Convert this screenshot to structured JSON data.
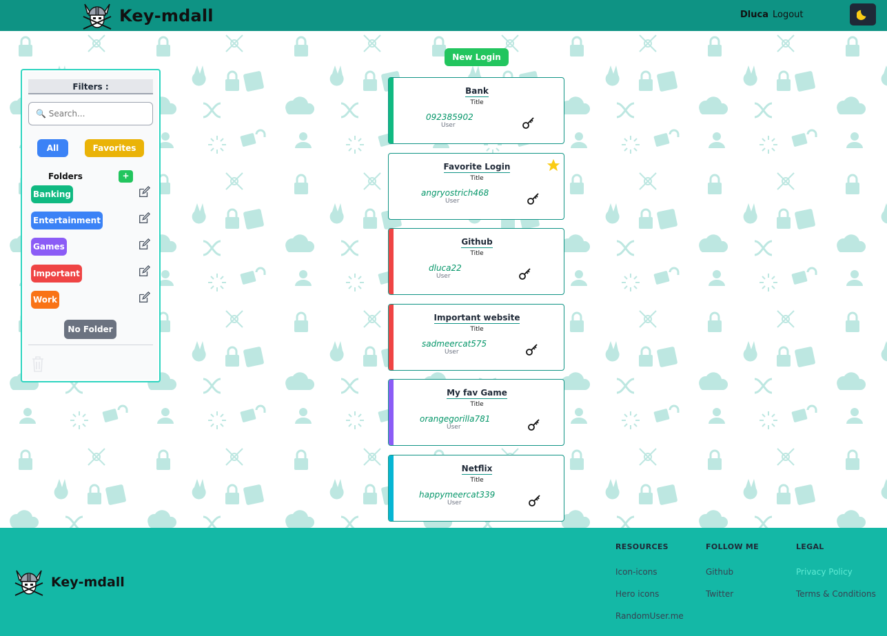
{
  "header": {
    "brand_name": "Key-mdall",
    "username": "Dluca",
    "logout_label": "Logout",
    "theme_icon": "moon-icon"
  },
  "sidebar": {
    "filters_title": "Filters :",
    "search_placeholder": "🔍 Search...",
    "all_label": "All",
    "favorites_label": "Favorites",
    "folders_label": "Folders",
    "add_folder_label": "+",
    "folders": [
      {
        "label": "Banking",
        "color": "#10b981"
      },
      {
        "label": "Entertainment",
        "color": "#3b82f6"
      },
      {
        "label": "Games",
        "color": "#8b5cf6"
      },
      {
        "label": "Important",
        "color": "#ef4444"
      },
      {
        "label": "Work",
        "color": "#f97316"
      }
    ],
    "no_folder_label": "No Folder"
  },
  "main": {
    "new_login_label": "New Login",
    "title_caption": "Title",
    "user_caption": "User",
    "logins": [
      {
        "title": "Bank",
        "user": "092385902",
        "color": "#10b981",
        "favorite": false
      },
      {
        "title": "Favorite Login",
        "user": "angryostrich468",
        "color": "",
        "favorite": true
      },
      {
        "title": "Github",
        "user": "dluca22",
        "color": "#ef4444",
        "favorite": false
      },
      {
        "title": "Important website",
        "user": "sadmeercat575",
        "color": "#ef4444",
        "favorite": false
      },
      {
        "title": "My fav Game",
        "user": "orangegorilla781",
        "color": "#8b5cf6",
        "favorite": false
      },
      {
        "title": "Netflix",
        "user": "happymeercat339",
        "color": "#06b6d4",
        "favorite": false
      }
    ]
  },
  "footer": {
    "brand_name": "Key-mdall",
    "resources_title": "RESOURCES",
    "resources": [
      "Icon-icons",
      "Hero icons",
      "RandomUser.me"
    ],
    "follow_title": "FOLLOW ME",
    "follow": [
      "Github",
      "Twitter"
    ],
    "legal_title": "LEGAL",
    "legal": [
      "Privacy Policy",
      "Terms & Conditions"
    ]
  }
}
